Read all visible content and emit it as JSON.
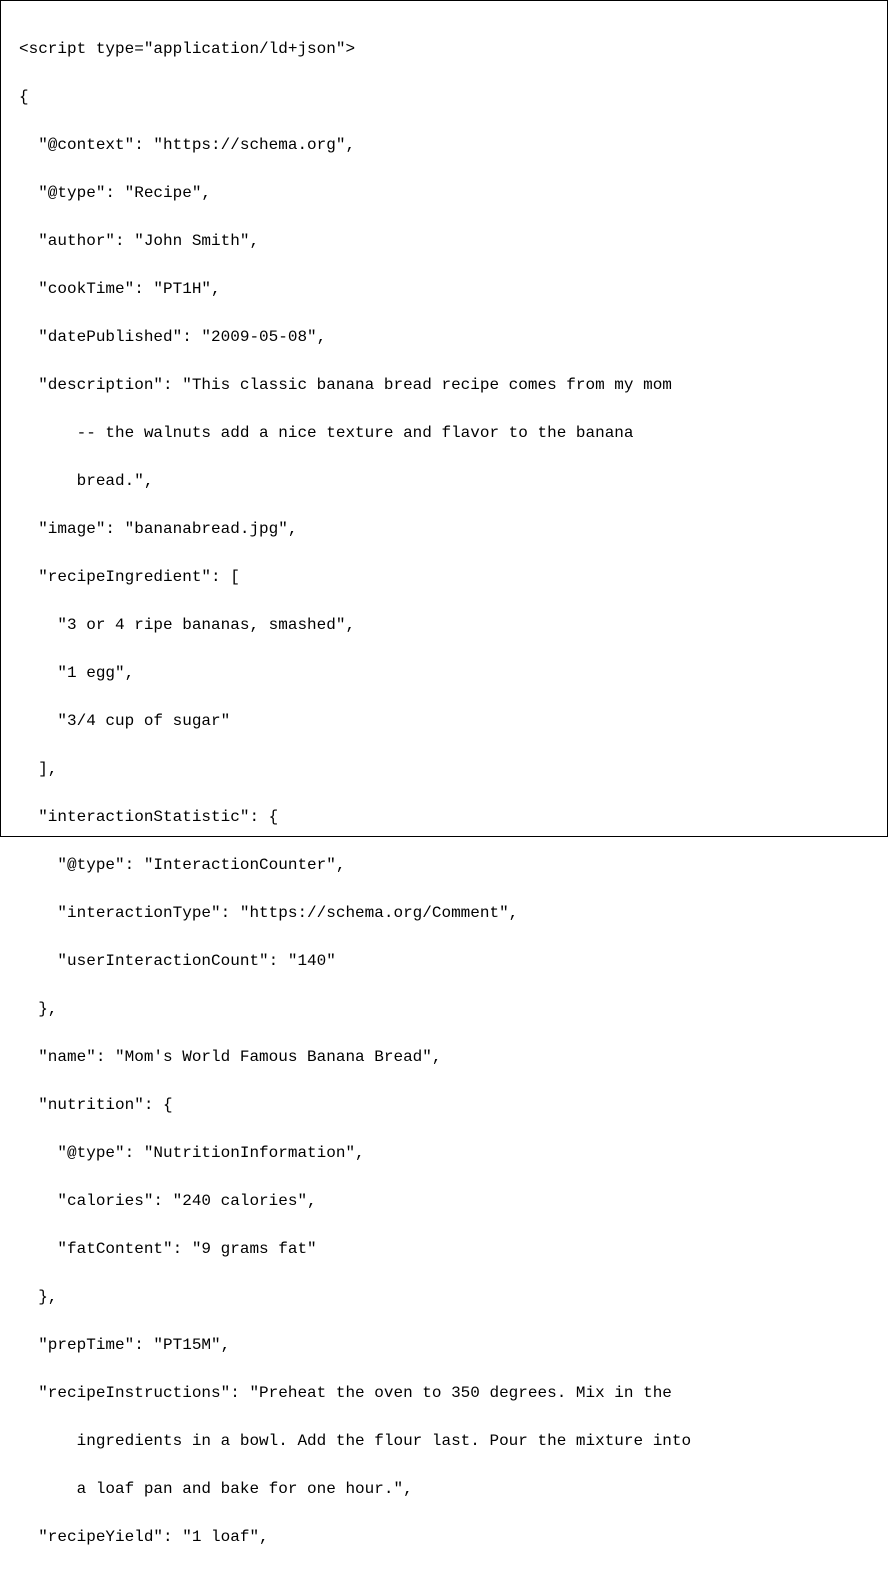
{
  "code": {
    "l01": "<script type=\"application/ld+json\">",
    "l02": "{",
    "l03": "\"@context\": \"https://schema.org\",",
    "l04": "\"@type\": \"Recipe\",",
    "l05": "\"author\": \"John Smith\",",
    "l06": "\"cookTime\": \"PT1H\",",
    "l07": "\"datePublished\": \"2009-05-08\",",
    "l08a": "\"description\": \"This classic banana bread recipe comes from my mom",
    "l08b": "-- the walnuts add a nice texture and flavor to the banana",
    "l08c": "bread.\",",
    "l09": "\"image\": \"bananabread.jpg\",",
    "l10": "\"recipeIngredient\": [",
    "l11": "\"3 or 4 ripe bananas, smashed\",",
    "l12": "\"1 egg\",",
    "l13": "\"3/4 cup of sugar\"",
    "l14": "],",
    "l15": "\"interactionStatistic\": {",
    "l16": "\"@type\": \"InteractionCounter\",",
    "l17": "\"interactionType\": \"https://schema.org/Comment\",",
    "l18": "\"userInteractionCount\": \"140\"",
    "l19": "},",
    "l20": "\"name\": \"Mom's World Famous Banana Bread\",",
    "l21": "\"nutrition\": {",
    "l22": "\"@type\": \"NutritionInformation\",",
    "l23": "\"calories\": \"240 calories\",",
    "l24": "\"fatContent\": \"9 grams fat\"",
    "l25": "},",
    "l26": "\"prepTime\": \"PT15M\",",
    "l27a": "\"recipeInstructions\": \"Preheat the oven to 350 degrees. Mix in the",
    "l27b": "ingredients in a bowl. Add the flour last. Pour the mixture into",
    "l27c": "a loaf pan and bake for one hour.\",",
    "l28": "\"recipeYield\": \"1 loaf\","
  }
}
